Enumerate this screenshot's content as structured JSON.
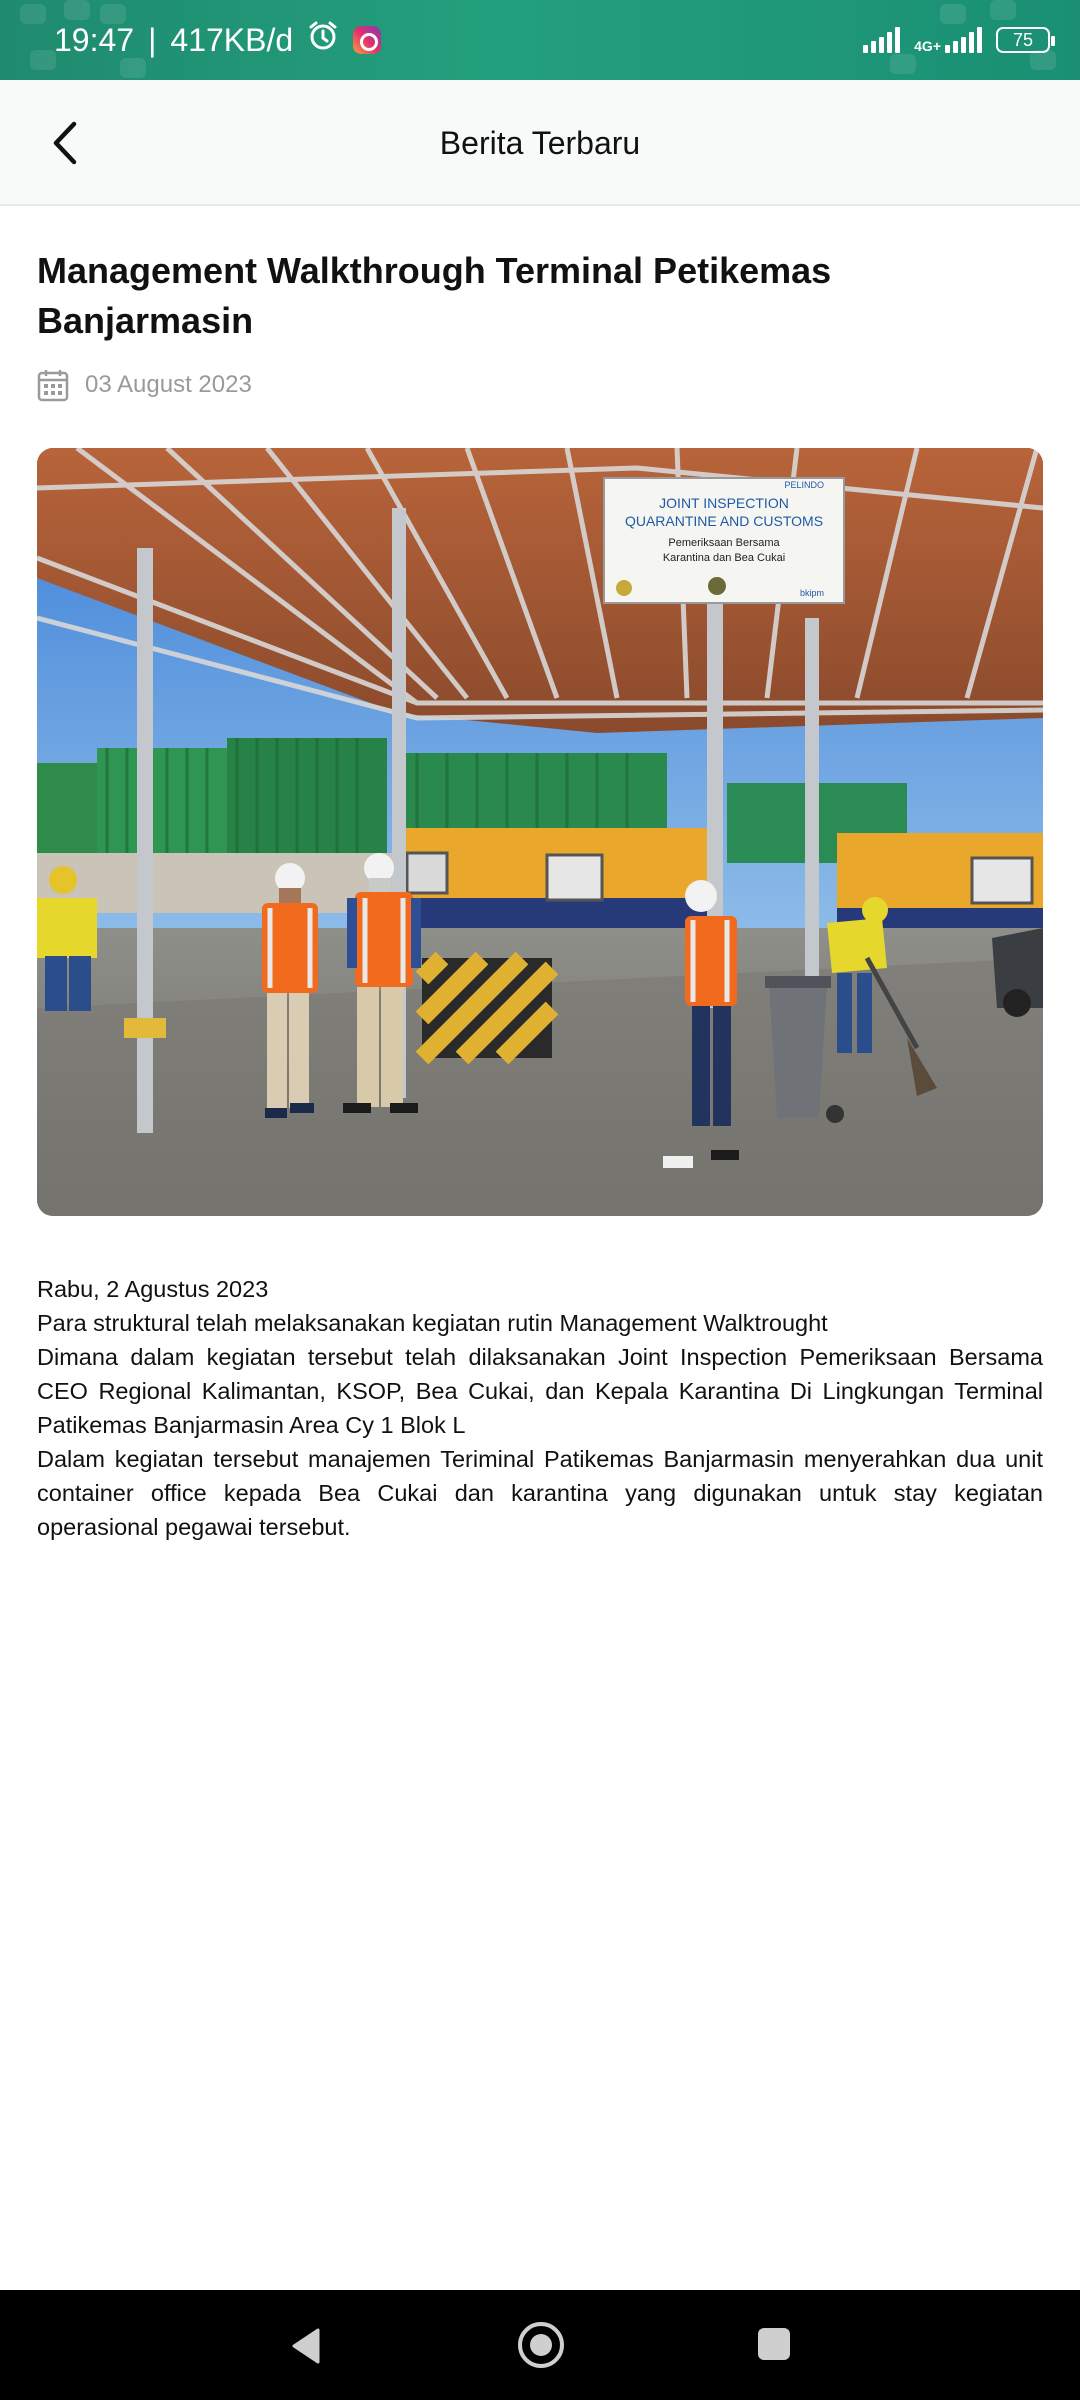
{
  "status_bar": {
    "time": "19:47",
    "separator": "|",
    "speed": "417KB/d",
    "network_label": "4G+",
    "battery": "75",
    "icons": [
      "alarm-icon",
      "instagram-icon",
      "signal-icon",
      "battery-icon"
    ]
  },
  "app_bar": {
    "title": "Berita Terbaru",
    "back_icon": "chevron-left-icon"
  },
  "article": {
    "title": "Management Walkthrough Terminal Petikemas Banjarmasin",
    "date": "03 August 2023",
    "image": {
      "sign_title_line1": "JOINT INSPECTION",
      "sign_title_line2": "QUARANTINE AND CUSTOMS",
      "sign_sub_line1": "Pemeriksaan Bersama",
      "sign_sub_line2": "Karantina dan Bea Cukai",
      "sign_brand": "PELINDO",
      "sign_brand2": "bkipm"
    },
    "paragraphs": [
      "Rabu, 2 Agustus 2023",
      "Para struktural telah melaksanakan kegiatan rutin Management Walktrought",
      "Dimana dalam kegiatan tersebut telah dilaksanakan Joint Inspection Pemeriksaan Bersama CEO Regional Kalimantan, KSOP, Bea Cukai, dan Kepala Karantina Di Lingkungan Terminal Patikemas Banjarmasin Area Cy 1 Blok L",
      "Dalam kegiatan tersebut manajemen Teriminal Patikemas Banjarmasin menyerahkan dua unit container office kepada Bea Cukai dan karantina yang digunakan untuk stay kegiatan operasional pegawai tersebut."
    ]
  },
  "nav_bar": {
    "icons": [
      "back-triangle-icon",
      "home-circle-icon",
      "recents-square-icon"
    ]
  },
  "colors": {
    "status_bar": "#1f8a6f",
    "app_bar_bg": "#f8f9f9",
    "date_text": "#9a9a9a",
    "vest_orange": "#f26a1b",
    "container_green": "#2e8b4a",
    "container_yellow": "#e9a72c"
  }
}
